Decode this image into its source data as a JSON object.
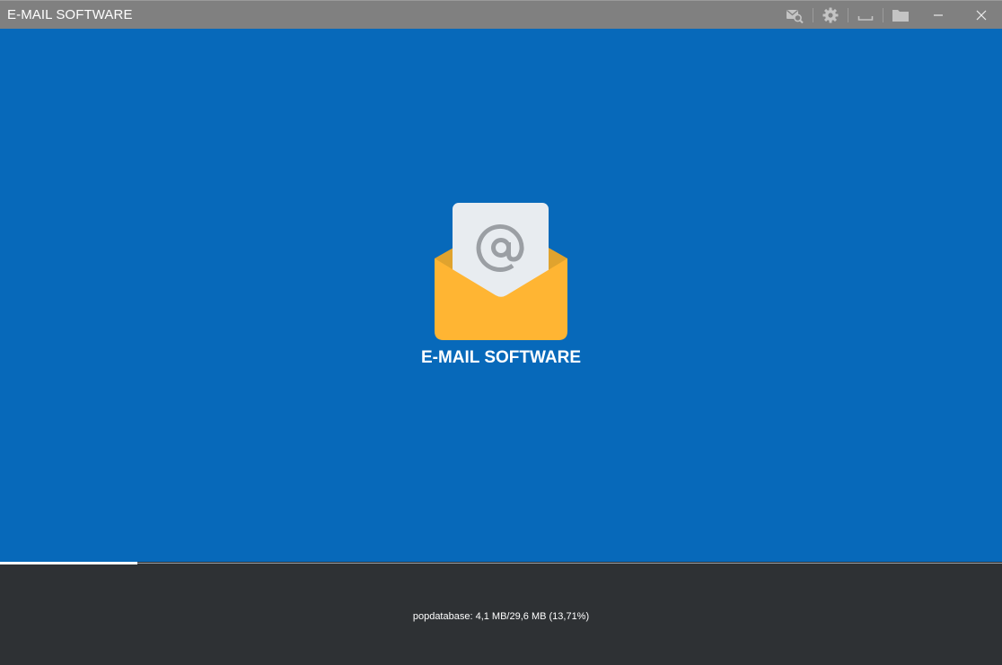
{
  "window": {
    "title": "E-MAIL SOFTWARE"
  },
  "toolbar": {
    "icons": [
      "search-mail-icon",
      "gear-icon",
      "underscore-icon",
      "folder-icon",
      "minimize-icon",
      "close-icon"
    ],
    "icon_color": "#c6c6c6"
  },
  "splash": {
    "app_name": "E-MAIL SOFTWARE",
    "logo_icon": "email-envelope-icon",
    "background_color": "#0769ba",
    "envelope_color": "#ffb533",
    "letter_color": "#e8ecf0"
  },
  "progress": {
    "percent": 13.71,
    "status_text": "popdatabase: 4,1 MB/29,6 MB (13,71%)"
  }
}
